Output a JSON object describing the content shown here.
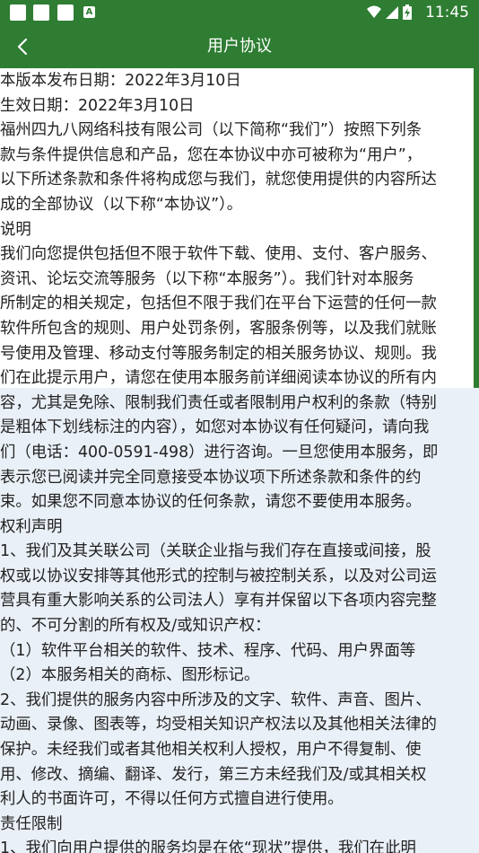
{
  "status_bar": {
    "time": "11:45",
    "notification_icons": [
      "notification-icon",
      "notification-icon",
      "notification-icon",
      "a-icon"
    ],
    "a_badge": "A",
    "system_icons": [
      "wifi-icon",
      "signal-icon",
      "battery-icon"
    ]
  },
  "app_bar": {
    "back_icon": "chevron-left-icon",
    "title": "用户协议"
  },
  "colors": {
    "primary_green": "#2e7d32",
    "page_bg": "#ffffff",
    "lower_bg": "#eaf0f7",
    "text": "#222222"
  },
  "agreement": {
    "lines": [
      "本版本发布日期：2022年3月10日",
      "生效日期：2022年3月10日",
      "福州四九八网络科技有限公司（以下简称“我们”）按照下列条",
      "款与条件提供信息和产品，您在本协议中亦可被称为“用户”，",
      "以下所述条款和条件将构成您与我们，就您使用提供的内容所达",
      "成的全部协议（以下称“本协议”）。",
      "说明",
      "我们向您提供包括但不限于软件下载、使用、支付、客户服务、",
      "资讯、论坛交流等服务（以下称“本服务”）。我们针对本服务",
      "所制定的相关规定，包括但不限于我们在平台下运营的任何一款",
      "软件所包含的规则、用户处罚条例，客服条例等，以及我们就账",
      "号使用及管理、移动支付等服务制定的相关服务协议、规则。我",
      "们在此提示用户，请您在使用本服务前详细阅读本协议的所有内",
      "容，尤其是免除、限制我们责任或者限制用户权利的条款（特别",
      "是粗体下划线标注的内容），如您对本协议有任何疑问，请向我",
      "们（电话：400-0591-498）进行咨询。一旦您使用本服务，即",
      "表示您已阅读并完全同意接受本协议项下所述条款和条件的约",
      "束。如果您不同意本协议的任何条款，请您不要使用本服务。",
      "权利声明",
      "1、我们及其关联公司（关联企业指与我们存在直接或间接，股",
      "权或以协议安排等其他形式的控制与被控制关系，以及对公司运",
      "营具有重大影响关系的公司法人）享有并保留以下各项内容完整",
      "的、不可分割的所有权及/或知识产权：",
      "（1）软件平台相关的软件、技术、程序、代码、用户界面等",
      "（2）本服务相关的商标、图形标记。",
      "2、我们提供的服务内容中所涉及的文字、软件、声音、图片、",
      "动画、录像、图表等，均受相关知识产权法以及其他相关法律的",
      "保护。未经我们或者其他相关权利人授权，用户不得复制、使",
      "用、修改、摘编、翻译、发行，第三方未经我们及/或其相关权",
      "利人的书面许可，不得以任何方式擅自进行使用。",
      "责任限制",
      "1、我们向用户提供的服务均是在依“现状”提供，我们在此明"
    ]
  }
}
